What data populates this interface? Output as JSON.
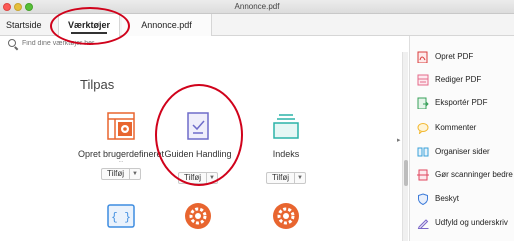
{
  "window": {
    "title": "Annonce.pdf"
  },
  "tabs": [
    {
      "label": "Startside"
    },
    {
      "label": "Værktøjer"
    },
    {
      "label": "Annonce.pdf"
    }
  ],
  "search": {
    "placeholder": "Find dine værktøjer her"
  },
  "section": {
    "title": "Tilpas"
  },
  "tools": [
    {
      "label": "Opret brugerdefineret",
      "label_partial": "...",
      "button": "Tilføj",
      "icon": "custom-tool-icon",
      "color": "#e8652f"
    },
    {
      "label": "Guiden Handling",
      "button": "Tilføj",
      "icon": "action-wizard-icon",
      "color": "#6e6cc9"
    },
    {
      "label": "Indeks",
      "button": "Tilføj",
      "icon": "index-icon",
      "color": "#2bb3a8"
    },
    {
      "label": "",
      "icon": "javascript-icon",
      "color": "#3d8ce0"
    },
    {
      "label": "",
      "icon": "gear-orange-icon",
      "color": "#e8652f"
    },
    {
      "label": "",
      "icon": "gear-orange-icon",
      "color": "#e8652f"
    }
  ],
  "right_panel": {
    "items": [
      {
        "label": "Opret PDF",
        "icon": "create-pdf-icon",
        "color": "#d93c3c"
      },
      {
        "label": "Rediger PDF",
        "icon": "edit-pdf-icon",
        "color": "#e46a8a"
      },
      {
        "label": "Eksportér PDF",
        "icon": "export-pdf-icon",
        "color": "#38a05a"
      },
      {
        "label": "Kommenter",
        "icon": "comment-icon",
        "color": "#f2b830"
      },
      {
        "label": "Organiser sider",
        "icon": "organize-pages-icon",
        "color": "#3aa0d9"
      },
      {
        "label": "Gør scanninger bedre",
        "icon": "enhance-scans-icon",
        "color": "#e0455e"
      },
      {
        "label": "Beskyt",
        "icon": "protect-icon",
        "color": "#3c7bd9"
      },
      {
        "label": "Udfyld og underskriv",
        "icon": "fill-sign-icon",
        "color": "#7a66c8"
      }
    ]
  },
  "colors": {
    "callout": "#d0021b",
    "accent": "#333333"
  }
}
